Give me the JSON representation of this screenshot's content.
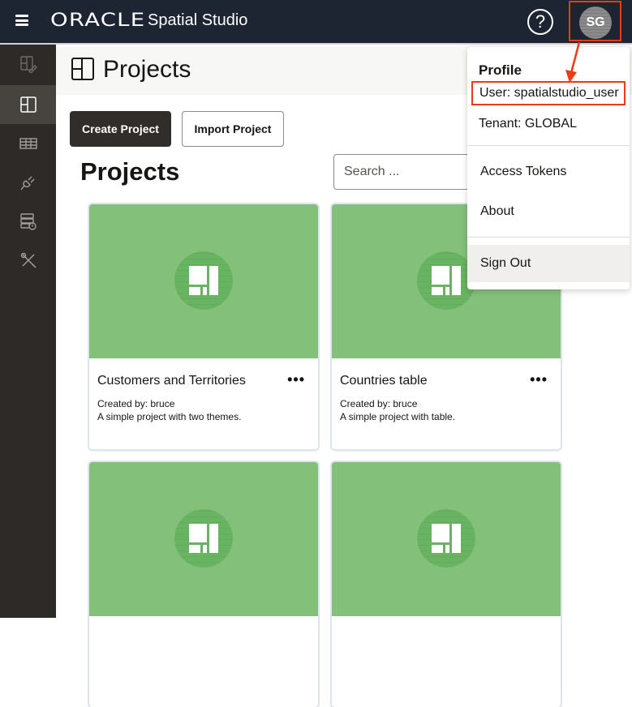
{
  "header": {
    "brand_oracle": "ORACLE",
    "brand_product": "Spatial Studio",
    "help_label": "?",
    "avatar_initials": "SG"
  },
  "sidebar": {
    "items": [
      {
        "name": "edit-projects",
        "icon": "layout-pencil-icon",
        "active": false
      },
      {
        "name": "projects",
        "icon": "layout-icon",
        "active": true
      },
      {
        "name": "datasets",
        "icon": "table-icon",
        "active": false
      },
      {
        "name": "connections",
        "icon": "plug-icon",
        "active": false
      },
      {
        "name": "jobs",
        "icon": "server-clock-icon",
        "active": false
      },
      {
        "name": "tools",
        "icon": "wrench-screwdriver-icon",
        "active": false
      }
    ]
  },
  "page": {
    "title": "Projects",
    "create_label": "Create Project",
    "import_label": "Import Project",
    "section_title": "Projects",
    "search_placeholder": "Search ..."
  },
  "projects": [
    {
      "title": "Customers and Territories",
      "created_by": "Created by: bruce",
      "description": "A simple project with two themes.",
      "menu": "•••"
    },
    {
      "title": "Countries table",
      "created_by": "Created by: bruce",
      "description": "A simple project with table.",
      "menu": "•••"
    },
    {
      "title": "",
      "created_by": "",
      "description": "",
      "menu": ""
    },
    {
      "title": "",
      "created_by": "",
      "description": "",
      "menu": ""
    }
  ],
  "profile_menu": {
    "header": "Profile",
    "user": "User: spatialstudio_user",
    "tenant": "Tenant: GLOBAL",
    "items": [
      "Access Tokens",
      "About",
      "Sign Out"
    ]
  },
  "colors": {
    "topbar": "#1e2532",
    "sidebar": "#2e2a28",
    "card_thumb": "#83c17b",
    "highlight": "#ee3a16"
  }
}
